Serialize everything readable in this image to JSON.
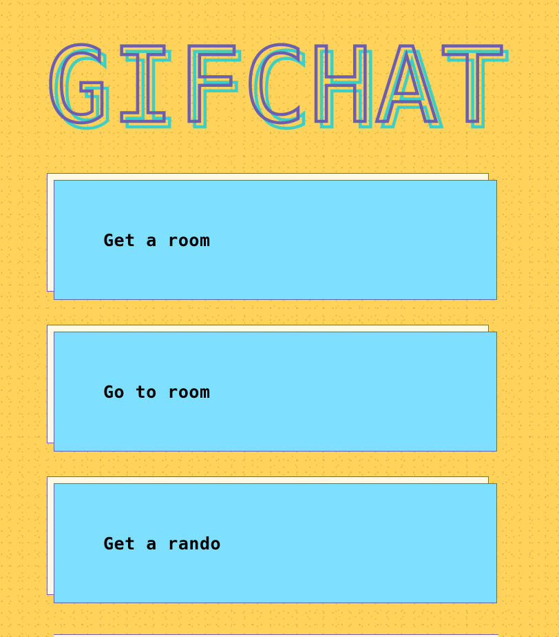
{
  "app": {
    "logo_text": "GIFCHAT"
  },
  "menu": {
    "items": [
      {
        "label": "Get a room"
      },
      {
        "label": "Go to room"
      },
      {
        "label": "Get a rando"
      }
    ]
  },
  "colors": {
    "background": "#ffd25a",
    "logo_primary": "#6c5fb0",
    "logo_shadow": "#3dcfc6",
    "card_front": "#7fdfff",
    "card_back": "#fffbe2",
    "card_border": "#6c5fb0",
    "label_text": "#000000"
  }
}
